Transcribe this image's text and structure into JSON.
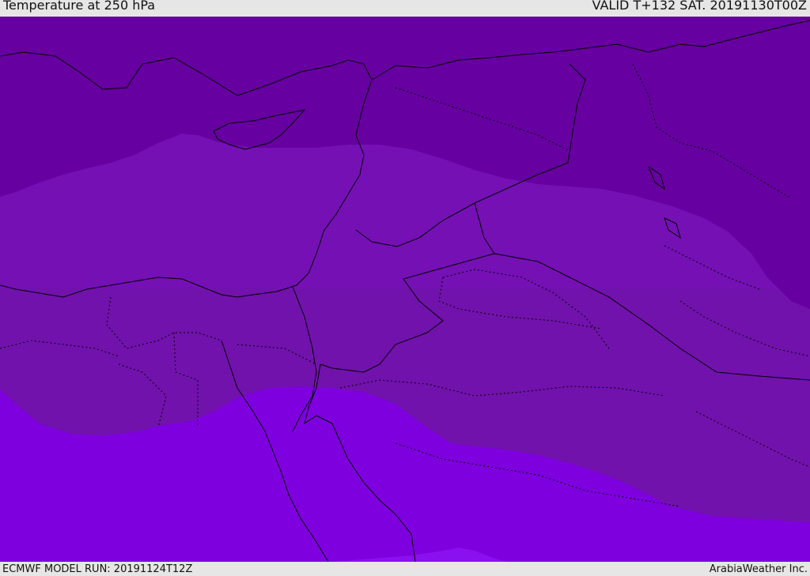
{
  "header": {
    "title": "Temperature at 250 hPa",
    "valid": "VALID T+132 SAT. 20191130T00Z"
  },
  "footer": {
    "model_run": "ECMWF MODEL RUN: 20191124T12Z",
    "provider": "ArabiaWeather Inc."
  },
  "colors": {
    "band_cold": "#6600a0",
    "band_mid_north": "#7410b4",
    "band_mid_south": "#7112ac",
    "band_warm": "#7e00de",
    "band_warmest": "#8a10f0",
    "coast_line": "#000000",
    "background": "#e6e6e6"
  }
}
